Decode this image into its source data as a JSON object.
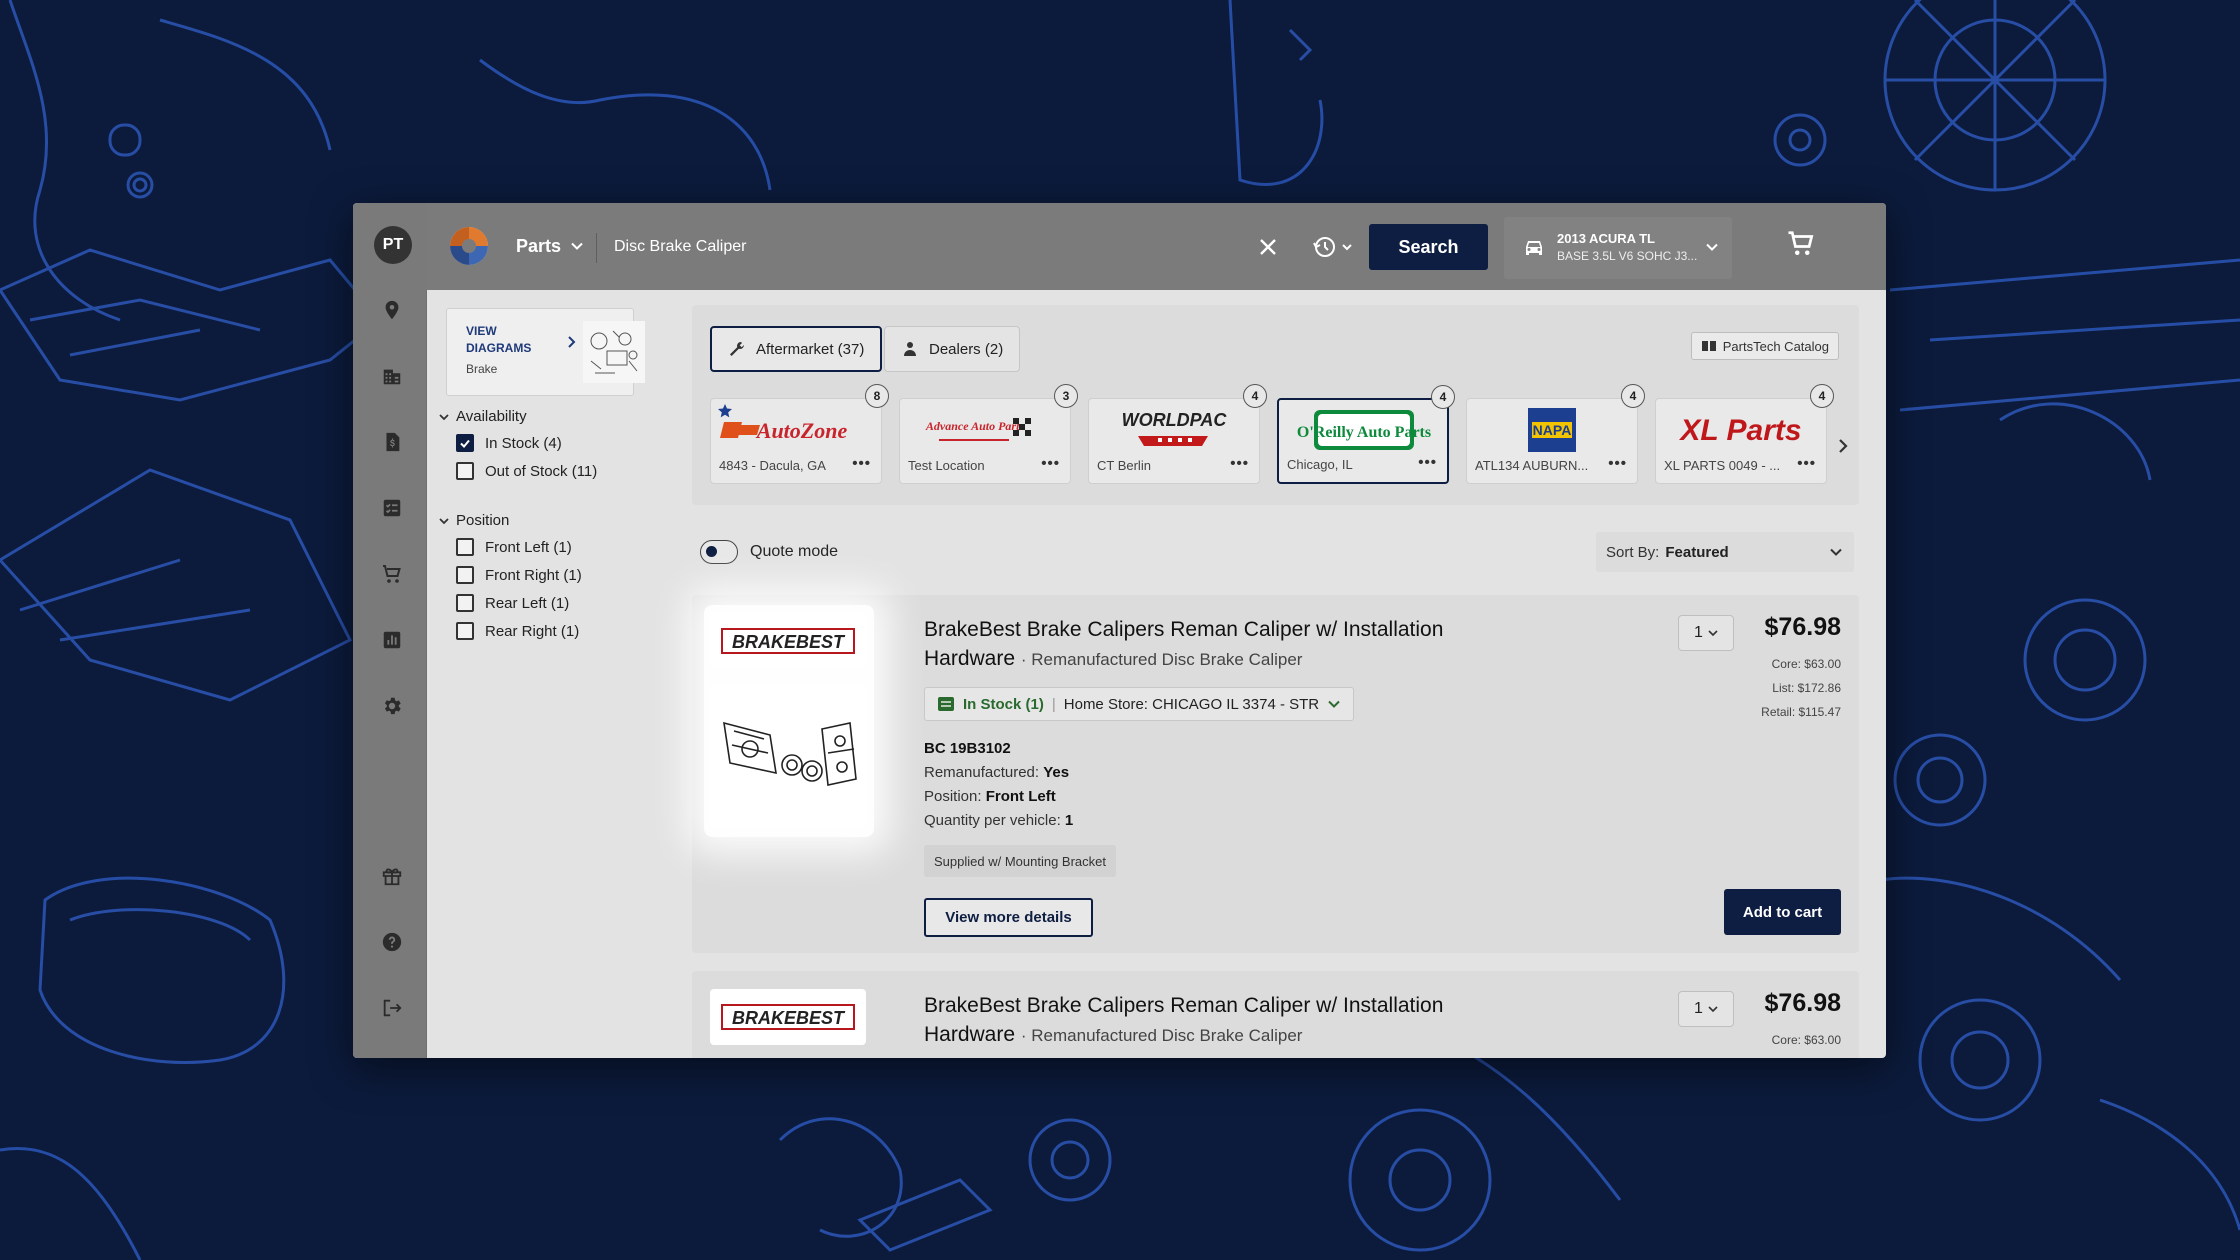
{
  "user": {
    "initials": "PT"
  },
  "rail_icons": [
    "location-icon",
    "building-icon",
    "invoice-icon",
    "checklist-icon",
    "cart-icon",
    "reports-icon",
    "settings-icon",
    "gift-icon",
    "help-icon",
    "logout-icon"
  ],
  "topbar": {
    "category": "Parts",
    "search_value": "Disc Brake Caliper",
    "search_button": "Search",
    "vehicle_line1": "2013 ACURA TL",
    "vehicle_line2": "BASE 3.5L V6 SOHC J3..."
  },
  "filters": {
    "diagrams": {
      "title": "VIEW DIAGRAMS",
      "subtitle": "Brake"
    },
    "availability": {
      "title": "Availability",
      "options": [
        {
          "label": "In Stock (4)",
          "checked": true
        },
        {
          "label": "Out of Stock (11)",
          "checked": false
        }
      ]
    },
    "position": {
      "title": "Position",
      "options": [
        {
          "label": "Front Left (1)",
          "checked": false
        },
        {
          "label": "Front Right (1)",
          "checked": false
        },
        {
          "label": "Rear Left (1)",
          "checked": false
        },
        {
          "label": "Rear Right (1)",
          "checked": false
        }
      ]
    }
  },
  "tabs": [
    {
      "label": "Aftermarket (37)",
      "active": true
    },
    {
      "label": "Dealers (2)",
      "active": false
    }
  ],
  "catalog_label": "PartsTech Catalog",
  "suppliers": [
    {
      "name": "AutoZone",
      "location": "4843 - Dacula, GA",
      "count": "8",
      "favorite": true,
      "selected": false,
      "color": "#e0501b"
    },
    {
      "name": "Advance Auto Parts",
      "location": "Test Location",
      "count": "3",
      "favorite": false,
      "selected": false,
      "color": "#c8242b"
    },
    {
      "name": "WORLDPAC",
      "location": "CT Berlin",
      "count": "4",
      "favorite": false,
      "selected": false,
      "color": "#c21a1a"
    },
    {
      "name": "O'Reilly Auto Parts",
      "location": "Chicago, IL",
      "count": "4",
      "favorite": false,
      "selected": true,
      "color": "#0d8a3c"
    },
    {
      "name": "NAPA",
      "location": "ATL134 AUBURN...",
      "count": "4",
      "favorite": false,
      "selected": false,
      "color": "#1d3f8f"
    },
    {
      "name": "XL Parts",
      "location": "XL PARTS 0049 - ...",
      "count": "4",
      "favorite": false,
      "selected": false,
      "color": "#c0171b"
    }
  ],
  "quote_mode": "Quote mode",
  "sort": {
    "label": "Sort By:",
    "value": "Featured"
  },
  "results": [
    {
      "brand": "BRAKEBEST",
      "title": "BrakeBest Brake Calipers Reman Caliper w/ Installation Hardware",
      "subtitle": "Remanufactured Disc Brake Caliper",
      "qty": "1",
      "price": "$76.98",
      "core": "Core: $63.00",
      "list": "List: $172.86",
      "retail": "Retail: $115.47",
      "stock": "In Stock (1)",
      "store": "Home Store: CHICAGO IL 3374 - STR",
      "part_number": "BC 19B3102",
      "specs": [
        {
          "label": "Remanufactured:",
          "value": "Yes"
        },
        {
          "label": "Position:",
          "value": "Front Left"
        },
        {
          "label": "Quantity per vehicle:",
          "value": "1"
        }
      ],
      "chip": "Supplied w/ Mounting Bracket",
      "details_button": "View more details",
      "cart_button": "Add to cart"
    },
    {
      "brand": "BRAKEBEST",
      "title": "BrakeBest Brake Calipers Reman Caliper w/ Installation Hardware",
      "subtitle": "Remanufactured Disc Brake Caliper",
      "qty": "1",
      "price": "$76.98",
      "core": "Core: $63.00"
    }
  ]
}
